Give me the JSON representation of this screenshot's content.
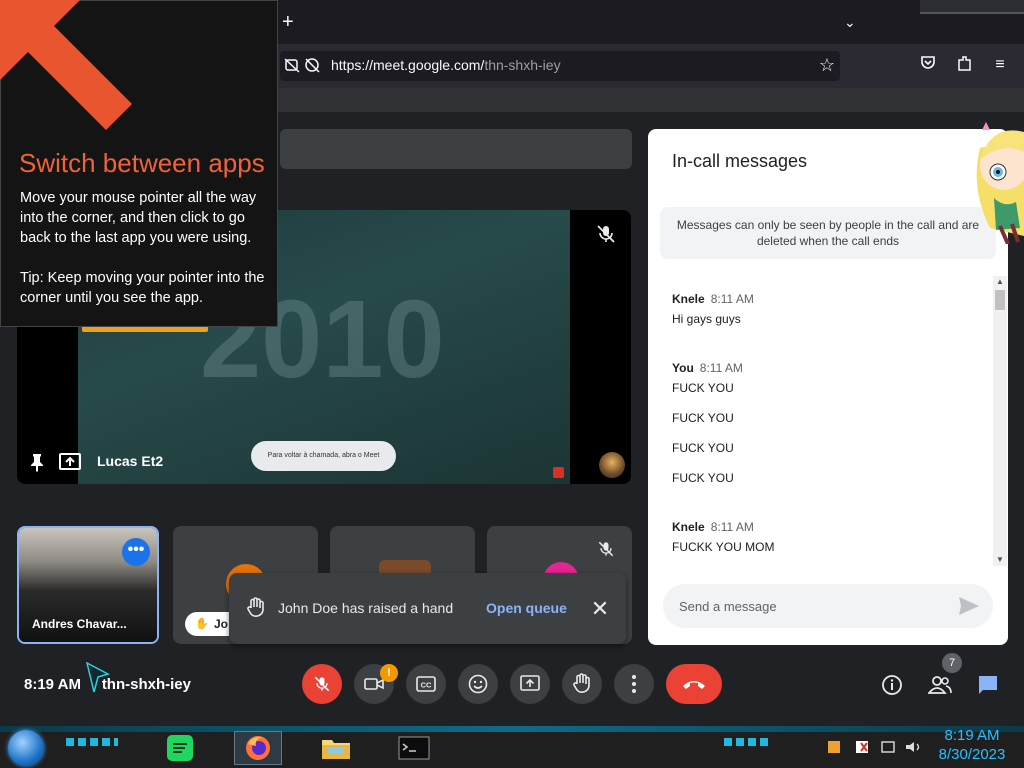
{
  "browser": {
    "url_host": "https://meet.google.com/",
    "url_path": "thn-shxh-iey"
  },
  "hint_overlay": {
    "title": "Switch between apps",
    "body": "Move your mouse pointer all the way into the corner, and then click to go back to the last app you were using.",
    "tip": "Tip: Keep moving your pointer into the corner until you see the app."
  },
  "main_tile": {
    "name": "Lucas Et2",
    "video_overlay_text": "2010",
    "video_pill_text": "Para voltar à chamada, abra o Meet"
  },
  "tiles": {
    "andres_name": "Andres Chavar...",
    "jo_name": "Jo"
  },
  "banner": {
    "text": "John Doe has raised a hand",
    "action": "Open queue"
  },
  "chat": {
    "title": "In-call messages",
    "notice": "Messages can only be seen by people in the call and are deleted when the call ends",
    "groups": [
      {
        "sender": "Knele",
        "time": "8:11 AM",
        "messages": [
          "Hi gays guys"
        ]
      },
      {
        "sender": "You",
        "time": "8:11 AM",
        "messages": [
          "FUCK YOU",
          "FUCK YOU",
          "FUCK YOU",
          "FUCK YOU"
        ]
      },
      {
        "sender": "Knele",
        "time": "8:11 AM",
        "messages": [
          "FUCKK YOU MOM"
        ]
      }
    ],
    "input_placeholder": "Send a message"
  },
  "controls": {
    "time": "8:19 AM",
    "meeting_code": "thn-shxh-iey",
    "camera_alert": "!",
    "people_count": "7"
  },
  "taskbar": {
    "time": "8:19 AM",
    "date": "8/30/2023"
  },
  "colors": {
    "accent_blue": "#8ab4f8",
    "danger_red": "#ea4335",
    "hint_title": "#f0623a",
    "tray_clock": "#27c1ff"
  }
}
